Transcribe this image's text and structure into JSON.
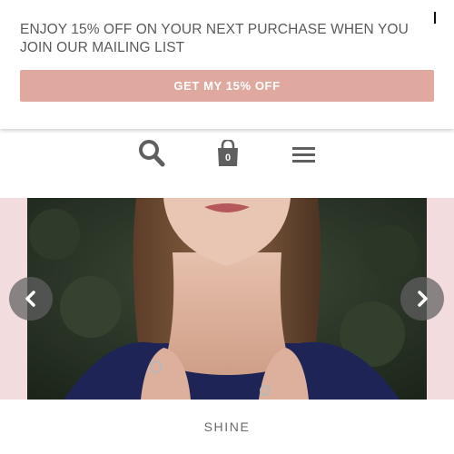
{
  "promo": {
    "message": "ENJOY 15% OFF ON YOUR NEXT PURCHASE WHEN YOU JOIN OUR MAILING LIST",
    "button_label": "GET MY 15% OFF",
    "button_color": "#dfa9a0",
    "close_icon": "close-icon"
  },
  "header": {
    "icons": [
      "search-icon",
      "shopping-bag-icon",
      "menu-icon"
    ],
    "cart_count": "0",
    "icon_color": "#5f5f5f"
  },
  "slider": {
    "background_color": "#f3dcdd",
    "prev_icon": "chevron-left-icon",
    "next_icon": "chevron-right-icon",
    "caption": "SHINE"
  }
}
